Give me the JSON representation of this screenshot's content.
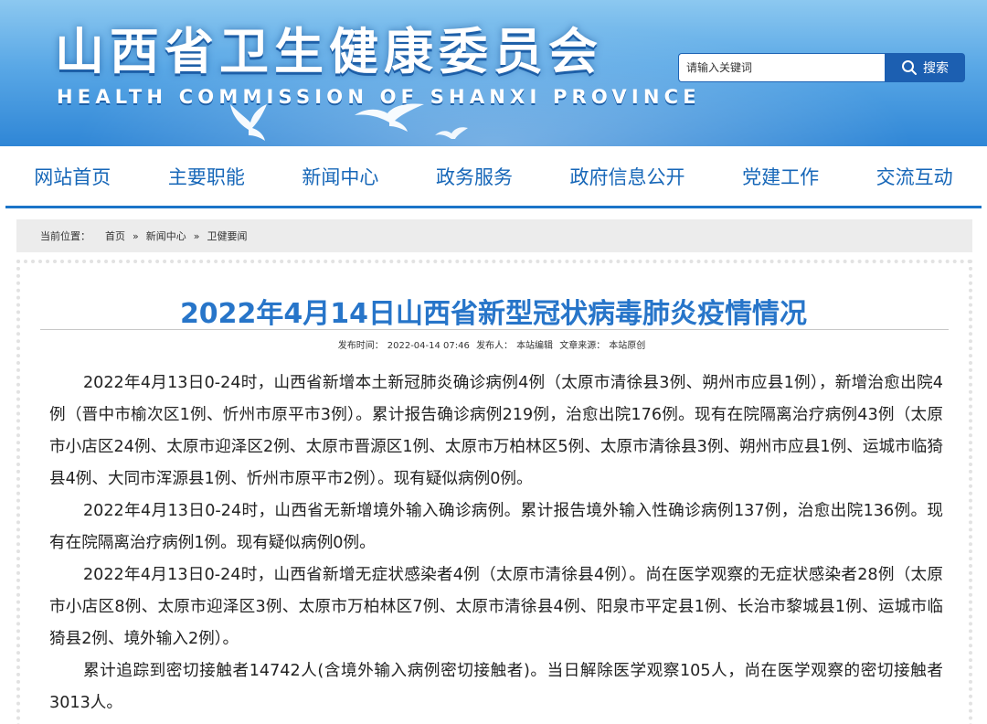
{
  "header": {
    "title": "山西省卫生健康委员会",
    "subtitle": "HEALTH COMMISSION OF SHANXI PROVINCE",
    "search_placeholder": "请输入关键词",
    "search_button": "搜索",
    "icons": [
      "dove-icon",
      "search-icon"
    ]
  },
  "nav": {
    "items": [
      "网站首页",
      "主要职能",
      "新闻中心",
      "政务服务",
      "政府信息公开",
      "党建工作",
      "交流互动"
    ]
  },
  "breadcrumb": {
    "label": "当前位置：",
    "items": [
      "首页",
      "新闻中心",
      "卫健要闻"
    ],
    "separator": "»"
  },
  "article": {
    "title": "2022年4月14日山西省新型冠状病毒肺炎疫情情况",
    "meta": {
      "time_label": "发布时间：",
      "time": "2022-04-14 07:46",
      "publisher_label": "发布人：",
      "publisher": "本站编辑",
      "source_label": "文章来源：",
      "source": "本站原创"
    },
    "paragraphs": [
      "2022年4月13日0-24时，山西省新增本土新冠肺炎确诊病例4例（太原市清徐县3例、朔州市应县1例），新增治愈出院4例（晋中市榆次区1例、忻州市原平市3例）。累计报告确诊病例219例，治愈出院176例。现有在院隔离治疗病例43例（太原市小店区24例、太原市迎泽区2例、太原市晋源区1例、太原市万柏林区5例、太原市清徐县3例、朔州市应县1例、运城市临猗县4例、大同市浑源县1例、忻州市原平市2例）。现有疑似病例0例。",
      "2022年4月13日0-24时，山西省无新增境外输入确诊病例。累计报告境外输入性确诊病例137例，治愈出院136例。现有在院隔离治疗病例1例。现有疑似病例0例。",
      "2022年4月13日0-24时，山西省新增无症状感染者4例（太原市清徐县4例）。尚在医学观察的无症状感染者28例（太原市小店区8例、太原市迎泽区3例、太原市万柏林区7例、太原市清徐县4例、阳泉市平定县1例、长治市黎城县1例、运城市临猗县2例、境外输入2例）。",
      "累计追踪到密切接触者14742人(含境外输入病例密切接触者)。当日解除医学观察105人，尚在医学观察的密切接触者3013人。"
    ]
  }
}
